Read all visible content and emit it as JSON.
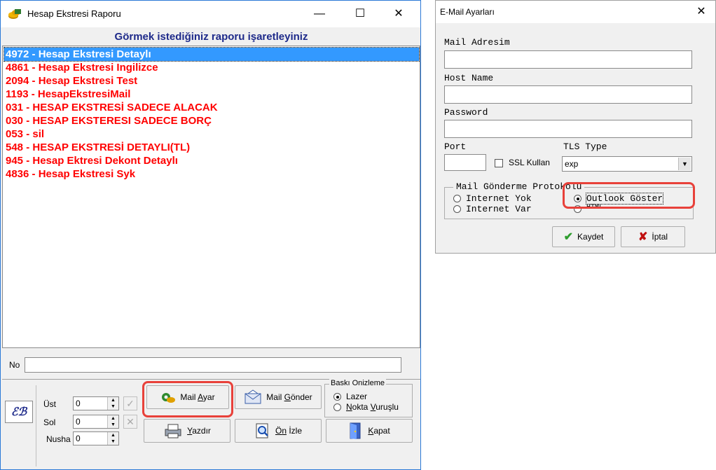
{
  "report_window": {
    "title": "Hesap Ekstresi Raporu",
    "controls": {
      "minimize": "—",
      "maximize": "☐",
      "close": "✕"
    },
    "list_header": "Görmek istediğiniz raporu işaretleyiniz",
    "reports": [
      "4972 - Hesap Ekstresi Detaylı",
      "4861 - Hesap Ekstresi Ingilizce",
      "2094 - Hesap Ekstresi Test",
      "1193 - HesapEkstresiMail",
      "031 - HESAP EKSTRESİ SADECE ALACAK",
      "030 - HESAP EKSTERESI SADECE BORÇ",
      "053 - sil",
      "548 - HESAP EKSTRESİ DETAYLI(TL)",
      "945 - Hesap Ektresi Dekont Detaylı",
      "4836 - Hesap Ekstresi Syk"
    ],
    "selected_index": 0,
    "no_label": "No",
    "no_value": "",
    "params": {
      "ust_label": "Üst",
      "ust_value": "0",
      "sol_label": "Sol",
      "sol_value": "0",
      "nusha_label": "Nusha",
      "nusha_value": "0"
    },
    "logo_text": "ℰℬ",
    "buttons": {
      "mail_ayar_pre": "Mail ",
      "mail_ayar_ul": "A",
      "mail_ayar_post": "yar",
      "mail_gonder_pre": "Mail ",
      "mail_gonder_ul": "G",
      "mail_gonder_post": "önder",
      "yazdir_ul": "Y",
      "yazdir_post": "azdır",
      "on_izle_ul": "Ö",
      "on_izle_mid": "n",
      "on_izle_post": " İzle",
      "kapat_ul": "K",
      "kapat_post": "apat"
    },
    "print_preview": {
      "legend": "Baskı Onizleme",
      "option_laser": "Lazer",
      "option_dot_pre": "",
      "option_dot_ul": "N",
      "option_dot_mid": "okta ",
      "option_dot_ul2": "V",
      "option_dot_post": "uruşlu",
      "selected": "Lazer"
    }
  },
  "mail_window": {
    "title": "E-Mail Ayarları",
    "close": "✕",
    "mail_address_label": "Mail Adresim",
    "mail_address_value": "",
    "host_label": "Host Name",
    "host_value": "",
    "password_label": "Password",
    "password_value": "",
    "port_label": "Port",
    "port_value": "",
    "ssl_label": "SSL Kullan",
    "ssl_checked": false,
    "tls_label": "TLS Type",
    "tls_value": "exp",
    "protocol_legend": "Mail Gönderme Protokolü",
    "protocol_options": [
      "Internet Yok",
      "Internet Var",
      "Outlook Göster",
      "HTML"
    ],
    "protocol_selected": "Outlook Göster",
    "save_label": "Kaydet",
    "cancel_label": "İptal"
  },
  "colors": {
    "highlight": "#e8413a",
    "report_text": "#ff0000",
    "selection": "#3399ff",
    "header_text": "#1e2a8a"
  }
}
